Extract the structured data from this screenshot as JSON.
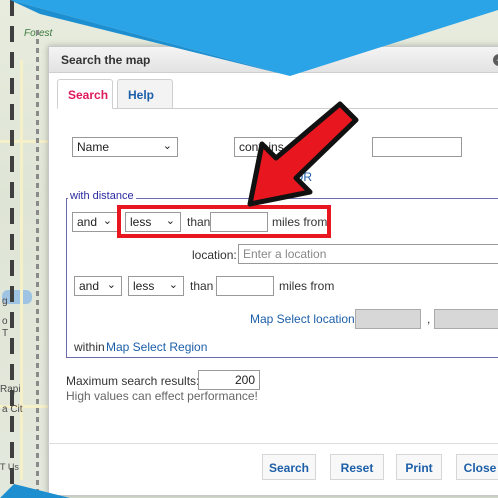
{
  "map": {
    "labels": [
      "Forest",
      "g",
      "o",
      "T",
      "Rapi",
      "a Cit",
      "T Us"
    ]
  },
  "dialog": {
    "title": "Search the map",
    "close_glyph": "−"
  },
  "tabs": [
    {
      "label": "Search",
      "active": true
    },
    {
      "label": "Help",
      "active": false
    }
  ],
  "name_row": {
    "field_select": "Name",
    "operator_select": "contains",
    "value": "",
    "or_link": "OR"
  },
  "distance": {
    "legend": "with distance",
    "row1": {
      "conj": "and",
      "cmp": "less",
      "than": "than",
      "value": "",
      "suffix": "miles from"
    },
    "location_label": "location:",
    "location_placeholder": "Enter a location",
    "row2": {
      "conj": "and",
      "cmp": "less",
      "than": "than",
      "value": "",
      "suffix": "miles from"
    },
    "map_select_location": "Map Select location",
    "coord_separator": ",",
    "within_label": "within",
    "map_select_region": "Map Select Region"
  },
  "results": {
    "label": "Maximum search results:",
    "value": "200",
    "note": "High values can effect performance!"
  },
  "buttons": {
    "search": "Search",
    "reset": "Reset",
    "print": "Print",
    "close": "Close"
  },
  "colors": {
    "banner": "#2aa4e6",
    "annotation_red": "#e8161e",
    "active_tab": "#e0185c",
    "link": "#1c5fa8"
  }
}
